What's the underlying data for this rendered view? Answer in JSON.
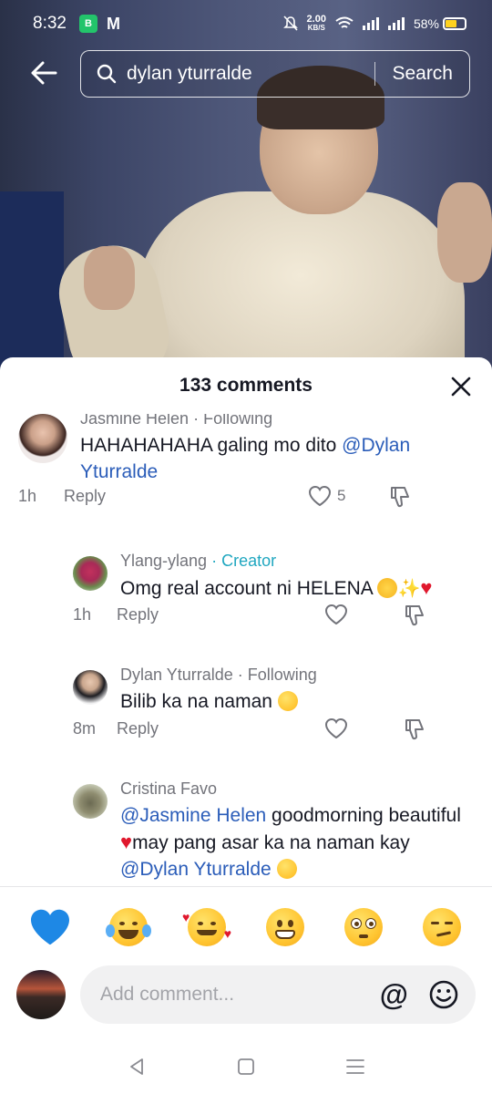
{
  "status_bar": {
    "time": "8:32",
    "app_icon": "B",
    "mail_icon": "M",
    "net_speed_value": "2.00",
    "net_speed_unit": "KB/S",
    "battery_percent": "58%",
    "battery_level": 0.58,
    "battery_color": "#ffd21e"
  },
  "search": {
    "query": "dylan yturralde",
    "button_label": "Search"
  },
  "comments_panel": {
    "count_label": "133 comments",
    "comments": [
      {
        "author": "Jasmine Helen",
        "relation": "· Following",
        "text": "HAHAHAHAHA galing mo dito ",
        "mention": "@Dylan Yturralde",
        "time": "1h",
        "reply_label": "Reply",
        "likes": "5"
      },
      {
        "author": "Ylang-ylang",
        "relation": "· Creator",
        "text": "Omg real account ni HELENA ",
        "time": "1h",
        "reply_label": "Reply"
      },
      {
        "author": "Dylan Yturralde",
        "relation": "· Following",
        "text": "Bilib ka na naman ",
        "time": "8m",
        "reply_label": "Reply"
      },
      {
        "author": "Cristina Favo",
        "mention_1": "@Jasmine Helen",
        "text_1": " goodmorning beautiful ",
        "text_2": "may pang asar ka na naman kay ",
        "mention_2": "@Dylan Yturralde"
      }
    ]
  },
  "emoji_bar": [
    "blue-heart",
    "joy",
    "smiling-face-with-hearts",
    "grin",
    "flushed",
    "smirk"
  ],
  "input": {
    "placeholder": "Add comment...",
    "at_label": "@"
  },
  "colors": {
    "mention": "#2b5db9",
    "creator": "#20a7c0",
    "muted": "#73747b",
    "heart_red": "#e0182d"
  }
}
